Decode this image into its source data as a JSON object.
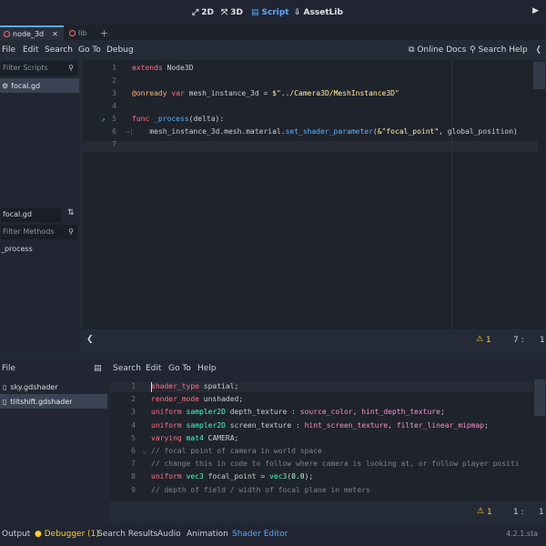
{
  "workspaces": [
    {
      "label": "2D",
      "icon": "2d-icon"
    },
    {
      "label": "3D",
      "icon": "3d-icon"
    },
    {
      "label": "Script",
      "icon": "script-icon"
    },
    {
      "label": "AssetLib",
      "icon": "assetlib-icon"
    }
  ],
  "scene_tabs": [
    "node_3d",
    "lib"
  ],
  "script_menu": [
    "File",
    "Edit",
    "Search",
    "Go To",
    "Debug"
  ],
  "online_docs": "Online Docs",
  "search_help": "Search Help",
  "filter_scripts_placeholder": "Filter Scripts",
  "script_files": [
    "focal.gd"
  ],
  "current_script_name": "focal.gd",
  "filter_methods_placeholder": "Filter Methods",
  "methods": [
    "_process"
  ],
  "script_code": {
    "line_numbers": [
      "1",
      "2",
      "3",
      "4",
      "5",
      "6",
      "7"
    ],
    "lines": [
      {
        "parts": [
          [
            "kw",
            "extends"
          ],
          [
            "plain",
            " Node3D"
          ]
        ]
      },
      {
        "parts": []
      },
      {
        "parts": [
          [
            "ann",
            "@onready"
          ],
          [
            "plain",
            " "
          ],
          [
            "kw",
            "var"
          ],
          [
            "plain",
            " mesh_instance_3d = "
          ],
          [
            "str",
            "$\"../Camera3D/MeshInstance3D\""
          ]
        ]
      },
      {
        "parts": []
      },
      {
        "parts": [
          [
            "kw",
            "func"
          ],
          [
            "plain",
            " "
          ],
          [
            "fn",
            "_process"
          ],
          [
            "plain",
            "(delta):"
          ]
        ]
      },
      {
        "parts": [
          [
            "plain",
            "    mesh_instance_3d.mesh.material."
          ],
          [
            "fn",
            "set_shader_parameter"
          ],
          [
            "plain",
            "("
          ],
          [
            "str",
            "&\"focal_point\""
          ],
          [
            "plain",
            ", global_position)"
          ]
        ]
      },
      {
        "parts": []
      }
    ]
  },
  "script_status": {
    "warnings": "1",
    "line": "7",
    "col": "1"
  },
  "shader_menu": [
    "File",
    "Search",
    "Edit",
    "Go To",
    "Help"
  ],
  "shader_files": [
    "sky.gdshader",
    "tiltshift.gdshader"
  ],
  "shader_code": {
    "line_numbers": [
      "1",
      "2",
      "3",
      "4",
      "5",
      "6",
      "7",
      "8",
      "9"
    ],
    "lines": [
      {
        "parts": [
          [
            "kw",
            "shader_type"
          ],
          [
            "plain",
            " spatial;"
          ]
        ]
      },
      {
        "parts": [
          [
            "kw",
            "render_mode"
          ],
          [
            "plain",
            " unshaded;"
          ]
        ]
      },
      {
        "parts": [
          [
            "kw",
            "uniform"
          ],
          [
            "plain",
            " "
          ],
          [
            "typ",
            "sampler2D"
          ],
          [
            "plain",
            " depth_texture : "
          ],
          [
            "ty2",
            "source_color"
          ],
          [
            "plain",
            ", "
          ],
          [
            "ty2",
            "hint_depth_texture"
          ],
          [
            "plain",
            ";"
          ]
        ]
      },
      {
        "parts": [
          [
            "kw",
            "uniform"
          ],
          [
            "plain",
            " "
          ],
          [
            "typ",
            "sampler2D"
          ],
          [
            "plain",
            " screen_texture : "
          ],
          [
            "ty2",
            "hint_screen_texture"
          ],
          [
            "plain",
            ", "
          ],
          [
            "ty2",
            "filter_linear_mipmap"
          ],
          [
            "plain",
            ";"
          ]
        ]
      },
      {
        "parts": [
          [
            "kw",
            "varying"
          ],
          [
            "plain",
            " "
          ],
          [
            "typ",
            "mat4"
          ],
          [
            "plain",
            " CAMERA;"
          ]
        ]
      },
      {
        "parts": [
          [
            "cmt",
            "// focal point of camera in world space"
          ]
        ]
      },
      {
        "parts": [
          [
            "cmt",
            "// change this in code to follow where camera is looking at, or follow player positi"
          ]
        ]
      },
      {
        "parts": [
          [
            "kw",
            "uniform"
          ],
          [
            "plain",
            " "
          ],
          [
            "typ",
            "vec3"
          ],
          [
            "plain",
            " focal_point = "
          ],
          [
            "typ",
            "vec3"
          ],
          [
            "plain",
            "("
          ],
          [
            "num",
            "0.0"
          ],
          [
            "plain",
            ");"
          ]
        ]
      },
      {
        "parts": [
          [
            "cmt",
            "// depth of field / width of focal plane in meters"
          ]
        ]
      }
    ]
  },
  "shader_status": {
    "warnings": "1",
    "line": "1",
    "col": "1"
  },
  "bottom_tabs": [
    "Output",
    "Debugger (1)",
    "Search Results",
    "Audio",
    "Animation",
    "Shader Editor"
  ],
  "version": "4.2.1.sta"
}
